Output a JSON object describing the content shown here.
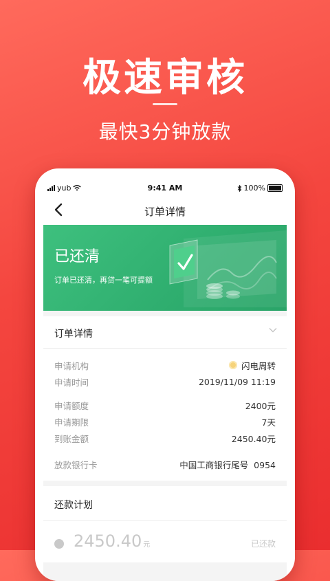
{
  "promo": {
    "headline": "极速审核",
    "subhead": "最快3分钟放款"
  },
  "status_bar": {
    "carrier": "yub",
    "time": "9:41 AM",
    "battery": "100%"
  },
  "nav": {
    "title": "订单详情"
  },
  "banner": {
    "status": "已还清",
    "message": "订单已还清，再贷一笔可提额"
  },
  "order_details": {
    "section_title": "订单详情",
    "institution_label": "申请机构",
    "institution_value": "闪电周转",
    "time_label": "申请时间",
    "time_value": "2019/11/09 11:19",
    "amount_label": "申请额度",
    "amount_value": "2400元",
    "term_label": "申请期限",
    "term_value": "7天",
    "received_label": "到账金额",
    "received_value": "2450.40元",
    "bank_label": "放款银行卡",
    "bank_value": "中国工商银行尾号  0954"
  },
  "repayment_plan": {
    "section_title": "还款计划",
    "amount": "2450.40",
    "unit": "元",
    "status": "已还款"
  },
  "colors": {
    "background": "#f4463f",
    "banner": "#2fae6f"
  }
}
